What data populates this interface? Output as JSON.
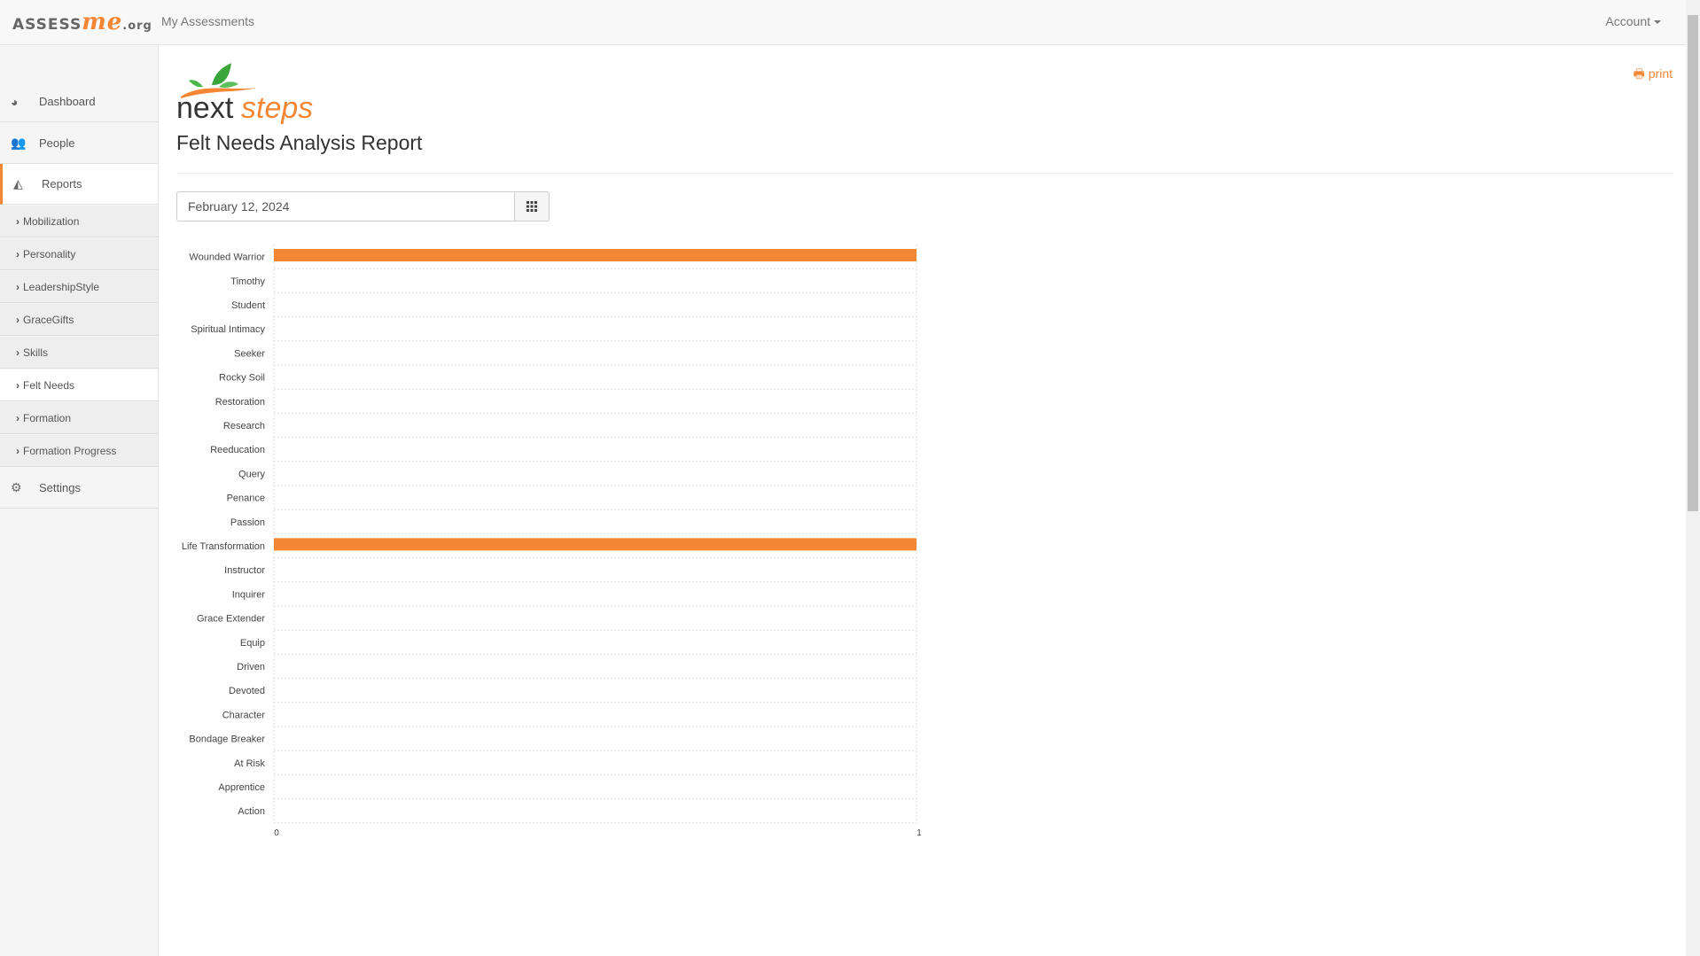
{
  "topbar": {
    "logo_text": "ASSESSme.org",
    "nav_link": "My Assessments",
    "account": "Account"
  },
  "sidebar": {
    "items": [
      {
        "label": "Dashboard",
        "icon": "dashboard-icon"
      },
      {
        "label": "People",
        "icon": "people-icon"
      },
      {
        "label": "Reports",
        "icon": "area-chart-icon"
      }
    ],
    "subitems": [
      "Mobilization",
      "Personality",
      "LeadershipStyle",
      "GraceGifts",
      "Skills",
      "Felt Needs",
      "Formation",
      "Formation Progress"
    ],
    "active_subitem": "Felt Needs",
    "settings": "Settings"
  },
  "main": {
    "logo_text": "nextsteps",
    "title": "Felt Needs Analysis Report",
    "print": "print",
    "date": "February 12, 2024"
  },
  "accent_color": "#f58634",
  "chart_data": {
    "type": "bar",
    "orientation": "horizontal",
    "categories": [
      "Wounded Warrior",
      "Timothy",
      "Student",
      "Spiritual Intimacy",
      "Seeker",
      "Rocky Soil",
      "Restoration",
      "Research",
      "Reeducation",
      "Query",
      "Penance",
      "Passion",
      "Life Transformation",
      "Instructor",
      "Inquirer",
      "Grace Extender",
      "Equip",
      "Driven",
      "Devoted",
      "Character",
      "Bondage Breaker",
      "At Risk",
      "Apprentice",
      "Action"
    ],
    "values": [
      1,
      0,
      0,
      0,
      0,
      0,
      0,
      0,
      0,
      0,
      0,
      0,
      1,
      0,
      0,
      0,
      0,
      0,
      0,
      0,
      0,
      0,
      0,
      0
    ],
    "xlim": [
      0,
      1
    ],
    "xticks": [
      "0",
      "1"
    ],
    "grid": true,
    "color": "#f58634"
  }
}
